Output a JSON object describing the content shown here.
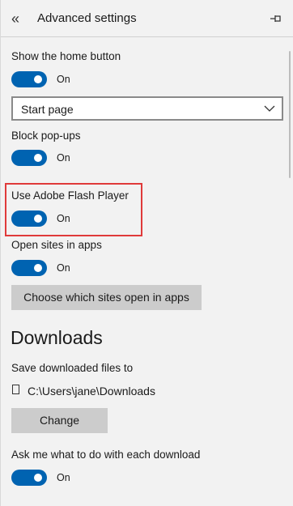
{
  "header": {
    "back_glyph": "«",
    "title": "Advanced settings",
    "pin_icon": "pin-icon"
  },
  "settings": {
    "home_button": {
      "label": "Show the home button",
      "state": "On"
    },
    "home_page_select": {
      "value": "Start page"
    },
    "popups": {
      "label": "Block pop-ups",
      "state": "On"
    },
    "flash": {
      "label": "Use Adobe Flash Player",
      "state": "On"
    },
    "open_in_apps": {
      "label": "Open sites in apps",
      "state": "On"
    },
    "choose_sites_button": "Choose which sites open in apps"
  },
  "downloads": {
    "heading": "Downloads",
    "save_label": "Save downloaded files to",
    "path": "C:\\Users\\jane\\Downloads",
    "change_button": "Change",
    "ask": {
      "label": "Ask me what to do with each download",
      "state": "On"
    }
  },
  "colors": {
    "toggle_on": "#0063b1",
    "highlight": "#e03a3a",
    "button_bg": "#cccccc",
    "pane_bg": "#f2f2f2"
  }
}
